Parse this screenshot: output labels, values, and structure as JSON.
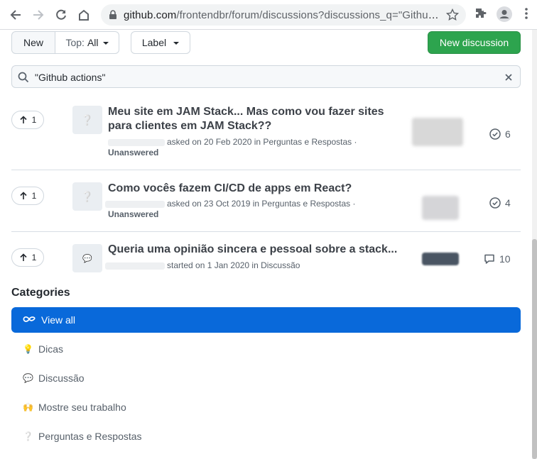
{
  "browser": {
    "url_host": "github.com",
    "url_path": "/frontendbr/forum/discussions?discussions_q=\"Github+a..."
  },
  "toolbar": {
    "new_label": "New",
    "top_prefix": "Top:",
    "top_value": "All",
    "label_label": "Label",
    "new_discussion_label": "New discussion"
  },
  "search": {
    "value": "\"Github actions\""
  },
  "discussions": [
    {
      "votes": "1",
      "title_line1": "Meu site em JAM Stack... Mas como vou fazer sites",
      "title_line2": "para clientes em JAM Stack??",
      "meta": "asked on 20 Feb 2020 in Perguntas e Respostas ·",
      "status": "Unanswered",
      "count": "6",
      "count_icon": "check-circle-icon"
    },
    {
      "votes": "1",
      "title_line1": "Como vocês fazem CI/CD de apps em React?",
      "meta": "asked on 23 Oct 2019 in Perguntas e Respostas ·",
      "status": "Unanswered",
      "count": "4",
      "count_icon": "check-circle-icon"
    },
    {
      "votes": "1",
      "title_line1": "Queria uma opinião sincera e pessoal sobre a stack...",
      "meta": "started on 1 Jan 2020 in Discussão",
      "count": "10",
      "count_icon": "comment-icon"
    }
  ],
  "categories": {
    "heading": "Categories",
    "items": [
      {
        "label": "View all",
        "icon": "infinity-icon"
      },
      {
        "label": "Dicas",
        "icon": "bulb-emoji"
      },
      {
        "label": "Discussão",
        "icon": "speech-bubble-emoji"
      },
      {
        "label": "Mostre seu trabalho",
        "icon": "raised-hands-emoji"
      },
      {
        "label": "Perguntas e Respostas",
        "icon": "question-emoji"
      }
    ]
  },
  "colors": {
    "primary_green": "#2da44e",
    "active_blue": "#0969da"
  }
}
